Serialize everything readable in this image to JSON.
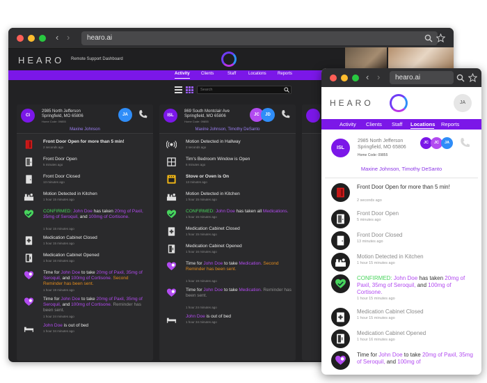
{
  "browser": {
    "url": "hearo.ai"
  },
  "app": {
    "logo": "HEARO",
    "subtitle": "Remote Support Dashboard"
  },
  "nav": {
    "tabs": [
      "Activity",
      "Clients",
      "Staff",
      "Locations",
      "Reports"
    ]
  },
  "search": {
    "placeholder": "Search"
  },
  "colors": {
    "accent": "#7b17e8",
    "highlight": "#b24bf0",
    "confirmed": "#48d45c",
    "reminder": "#e38c1d",
    "alert": "#d81b1b",
    "stove": "#f2b716"
  },
  "panel1": {
    "avatar": "CI",
    "addr1": "2985 North Jefferson",
    "addr2": "Springfield, MO 65806",
    "home_code": "Home Code: 09855",
    "staff_avatars": [
      "JA"
    ],
    "assigned": "Maxine Johnson",
    "events": [
      {
        "icon": "door-open-alert-icon",
        "text": "Front Door Open for more than 5 min!",
        "time": "2 seconds ago"
      },
      {
        "icon": "door-open-icon",
        "text": "Front Door Open",
        "time": "5 minutes ago"
      },
      {
        "icon": "door-closed-icon",
        "text": "Front Door Closed",
        "time": "13 minutes ago"
      },
      {
        "icon": "kitchen-motion-icon",
        "text": "Motion Detected in Kitchen",
        "time": "1 hour 15 minutes ago"
      },
      {
        "icon": "confirmed-heart-icon",
        "pre": "CONFIRMED:",
        "name": "John Doe",
        "mid": "has taken",
        "meds": "20mg of Paxil, 35mg of Seroquil,",
        "and": "and",
        "meds2": "100mg of Cortisone.",
        "time": "1 hour 15 minutes ago"
      },
      {
        "icon": "cabinet-closed-icon",
        "text": "Medication Cabinet Closed",
        "time": "1 hour 15 minutes ago"
      },
      {
        "icon": "cabinet-opened-icon",
        "text": "Medication Cabinet Opened",
        "time": "1 hour 16 minutes ago"
      },
      {
        "icon": "reminder-heart-icon",
        "pre": "Time for",
        "name": "John Doe",
        "mid": "to take",
        "meds": "20mg of Paxil, 35mg of Seroquil,",
        "and": "and",
        "meds2": "100mg of Cortisone.",
        "reminder": "Second Reminder has been sent.",
        "time": "1 hour 19 minutes ago"
      },
      {
        "icon": "reminder-heart-icon",
        "pre": "Time for",
        "name": "John Doe",
        "mid": "to take",
        "meds": "20mg of Paxil, 35mg of Seroquil,",
        "and": "and",
        "meds2": "100mg of Cortisone.",
        "reminder": "Reminder has been sent.",
        "time": "1 hour 24 minutes ago"
      },
      {
        "icon": "bed-icon",
        "name": "John Doe",
        "text": "is out of bed",
        "time": "1 hour 34 minutes ago"
      }
    ]
  },
  "panel2": {
    "avatar": "ISL",
    "addr1": "869 South Montclair Ave",
    "addr2": "Springfield, MO 65806",
    "home_code": "Home Code: 09855",
    "staff_avatars": [
      "JC",
      "JD"
    ],
    "assigned": "Maxine Johnson, Timothy DeSanto",
    "events": [
      {
        "icon": "motion-hallway-icon",
        "text": "Motion Detected in Hallway",
        "time": "2 seconds ago"
      },
      {
        "icon": "window-icon",
        "text": "Tim's Bedroom Window is Open",
        "time": "5 minutes ago"
      },
      {
        "icon": "stove-icon",
        "text": "Stove or Oven is On",
        "time": "13 minutes ago"
      },
      {
        "icon": "kitchen-motion-icon",
        "text": "Motion Detected in Kitchen",
        "time": "1 hour 15 minutes ago"
      },
      {
        "icon": "confirmed-heart-icon",
        "pre": "CONFIRMED:",
        "name": "John Doe",
        "mid": "has taken all",
        "meds": "Medications.",
        "time": "1 hour 15 minutes ago"
      },
      {
        "icon": "cabinet-closed-icon",
        "text": "Medication Cabinet Closed",
        "time": "1 hour 15 minutes ago"
      },
      {
        "icon": "cabinet-opened-icon",
        "text": "Medication Cabinet Opened",
        "time": "1 hour 16 minutes ago"
      },
      {
        "icon": "reminder-heart-icon",
        "pre": "Time for",
        "name": "John Doe",
        "mid": "to take",
        "meds": "Medication.",
        "reminder": "Second Reminder has been sent.",
        "time": "1 hour 19 minutes ago"
      },
      {
        "icon": "reminder-heart-icon",
        "pre": "Time for",
        "name": "John Doe",
        "mid": "to take",
        "meds": "Medication.",
        "reminder": "Reminder has been sent.",
        "time": "1 hour 24 minutes ago"
      },
      {
        "icon": "bed-icon",
        "name": "John Doe",
        "text": "is out of bed",
        "time": "1 hour 34 minutes ago"
      }
    ]
  },
  "front": {
    "url": "hearo.ai",
    "logo": "HEARO",
    "user_avatar": "JA",
    "active_tab": "Locations",
    "card": {
      "avatar": "ISL",
      "addr1": "2985 North Jefferson",
      "addr2": "Springfield, MO 65806",
      "home_code": "Home Code: 09855",
      "staff_avatars": [
        "JC",
        "JC",
        "JA"
      ],
      "assigned": "Maxine Johnson, Timothy DeSanto"
    },
    "events": [
      {
        "icon": "door-open-alert-icon",
        "text": "Front Door Open for more than 5 min!",
        "time": "2 seconds ago"
      },
      {
        "icon": "door-open-icon",
        "text": "Front Door Open",
        "time": "5 minutes ago"
      },
      {
        "icon": "door-closed-icon",
        "text": "Front Door Closed",
        "time": "13 minutes ago"
      },
      {
        "icon": "kitchen-motion-icon",
        "text": "Motion Detected in Kitchen",
        "time": "1 hour 15 minutes ago"
      },
      {
        "icon": "confirmed-heart-icon",
        "pre": "CONFIRMED:",
        "name": "John Doe",
        "mid": "has taken",
        "meds": "20mg of Paxil, 35mg of Seroquil,",
        "and": "and",
        "meds2": "100mg of Cortisone.",
        "time": "1 hour 15 minutes ago"
      },
      {
        "icon": "cabinet-closed-icon",
        "text": "Medication Cabinet Closed",
        "time": "1 hour 15 minutes ago"
      },
      {
        "icon": "cabinet-opened-icon",
        "text": "Medication Cabinet Opened",
        "time": "1 hour 16 minutes ago"
      },
      {
        "icon": "reminder-heart-icon",
        "pre": "Time for",
        "name": "John Doe",
        "mid": "to take",
        "meds": "20mg of Paxil, 35mg of Seroquil,",
        "and": "and",
        "meds2": "100mg of",
        "time": ""
      }
    ]
  }
}
